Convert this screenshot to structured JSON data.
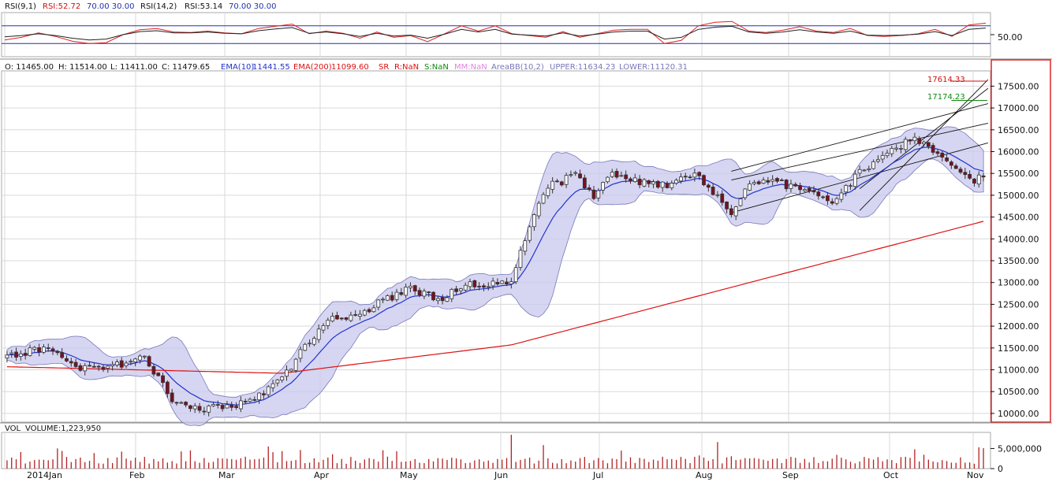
{
  "rsi_panel": {
    "label": "RSI(9,1)",
    "rsi9": "RSI:52.72",
    "levels1": "70.00 30.00",
    "label2": "RSI(14,2)",
    "rsi14": "RSI:53.14",
    "levels2": "70.00 30.00",
    "axis_label": "50.00"
  },
  "price_panel": {
    "open": "O: 11465.00",
    "high": "H: 11514.00",
    "low": "L: 11411.00",
    "close": "C: 11479.65",
    "ema10_label": "EMA(10)",
    "ema10_value": "11441.55",
    "ema200_label": "EMA(200)",
    "ema200_value": "11099.60",
    "sr_label": "SR",
    "r_label": "R:NaN",
    "s_label": "S:NaN",
    "mm_label": "MM:NaN",
    "bb_label": "AreaBB(10,2)",
    "upper_label": "UPPER:11634.23",
    "lower_label": "LOWER:11120.31",
    "marker_high": "17614.33",
    "marker_low": "17174.23"
  },
  "volume_panel": {
    "label": "VOL",
    "value": "VOLUME:1,223,950"
  },
  "colors": {
    "up": "#ffffff",
    "down": "#7a1020",
    "ema10": "#2233cc",
    "ema200": "#dd1111",
    "band_fill": "#c8c8ee",
    "band_line": "#7777bb",
    "rsi9": "#e02020",
    "rsi14": "#222222",
    "volume": "#b22222",
    "grid": "#d9d9d9"
  },
  "chart_data": {
    "type": "candlestick",
    "ylim": [
      9800,
      17850
    ],
    "yticks": [
      "10000.00",
      "10500.00",
      "11000.00",
      "11500.00",
      "12000.00",
      "12500.00",
      "13000.00",
      "13500.00",
      "14000.00",
      "14500.00",
      "15000.00",
      "15500.00",
      "16000.00",
      "16500.00",
      "17000.00",
      "17500.00"
    ],
    "x_labels": [
      "2014Jan",
      "Feb",
      "Mar",
      "Apr",
      "May",
      "Jun",
      "Jul",
      "Aug",
      "Sep",
      "Oct",
      "Nov"
    ],
    "volume_ticks": [
      "5,000,000",
      "0"
    ],
    "trading_days": 214,
    "anchors": [
      [
        0,
        11300
      ],
      [
        8,
        11500
      ],
      [
        16,
        11000
      ],
      [
        24,
        11100
      ],
      [
        30,
        11300
      ],
      [
        36,
        10300
      ],
      [
        42,
        10100
      ],
      [
        50,
        10200
      ],
      [
        56,
        10450
      ],
      [
        60,
        10800
      ],
      [
        64,
        11400
      ],
      [
        70,
        12200
      ],
      [
        76,
        12200
      ],
      [
        82,
        12600
      ],
      [
        88,
        12850
      ],
      [
        94,
        12600
      ],
      [
        100,
        13000
      ],
      [
        106,
        12950
      ],
      [
        110,
        13000
      ],
      [
        114,
        14300
      ],
      [
        118,
        15200
      ],
      [
        124,
        15450
      ],
      [
        128,
        15000
      ],
      [
        132,
        15500
      ],
      [
        138,
        15300
      ],
      [
        144,
        15200
      ],
      [
        150,
        15500
      ],
      [
        154,
        15100
      ],
      [
        158,
        14600
      ],
      [
        162,
        15300
      ],
      [
        168,
        15300
      ],
      [
        174,
        15100
      ],
      [
        180,
        14900
      ],
      [
        186,
        15500
      ],
      [
        192,
        16000
      ],
      [
        198,
        16300
      ],
      [
        204,
        15900
      ],
      [
        210,
        15300
      ],
      [
        216,
        15600
      ],
      [
        222,
        16400
      ],
      [
        228,
        17000
      ],
      [
        232,
        17300
      ],
      [
        236,
        17400
      ]
    ],
    "rsi9": [
      38,
      44,
      54,
      46,
      35,
      30,
      32,
      50,
      61,
      64,
      56,
      55,
      58,
      54,
      52,
      64,
      69,
      74,
      52,
      58,
      53,
      42,
      56,
      44,
      48,
      34,
      52,
      70,
      58,
      70,
      52,
      48,
      44,
      57,
      44,
      52,
      60,
      62,
      62,
      30,
      37,
      70,
      78,
      80,
      58,
      55,
      60,
      68,
      58,
      55,
      64,
      48,
      46,
      48,
      52,
      62,
      46,
      72,
      76
    ],
    "rsi14": [
      45,
      48,
      52,
      48,
      42,
      38,
      40,
      50,
      57,
      59,
      54,
      54,
      56,
      53,
      52,
      59,
      63,
      66,
      53,
      56,
      52,
      46,
      53,
      47,
      49,
      42,
      51,
      62,
      56,
      62,
      51,
      49,
      47,
      54,
      47,
      51,
      56,
      58,
      58,
      40,
      44,
      62,
      67,
      69,
      56,
      53,
      56,
      61,
      56,
      53,
      58,
      49,
      48,
      49,
      51,
      57,
      48,
      62,
      65
    ]
  }
}
